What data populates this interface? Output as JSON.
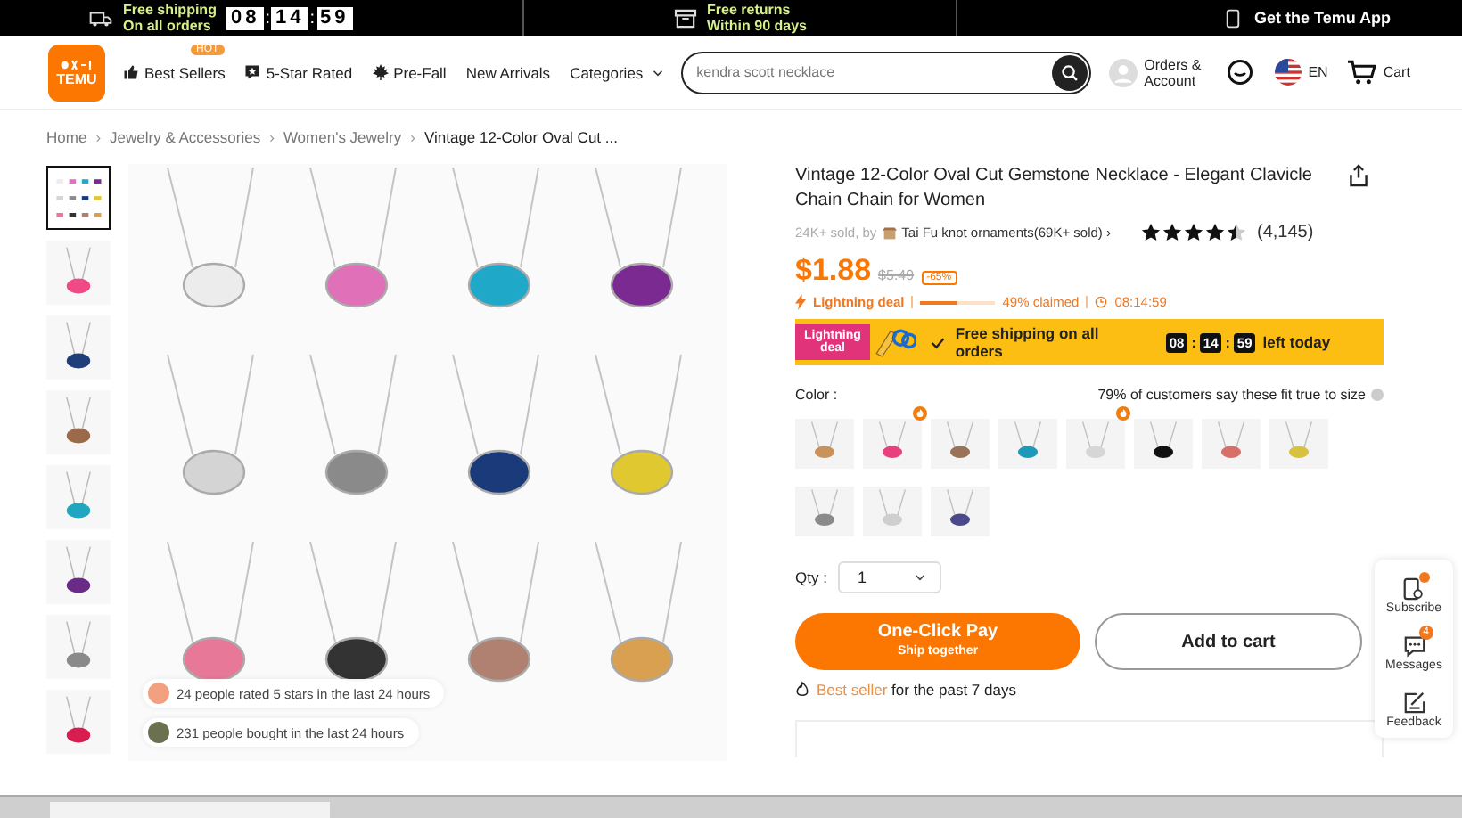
{
  "top_bar": {
    "promos": [
      {
        "kind": "shipping",
        "lines": [
          "Free shipping",
          "On all orders"
        ],
        "timer": {
          "parts": [
            "08",
            "14",
            "59"
          ],
          "separator": ":"
        }
      },
      {
        "kind": "returns",
        "lines": [
          "Free returns",
          "Within 90 days"
        ]
      },
      {
        "kind": "app",
        "lines": [
          "Get the Temu App"
        ]
      }
    ]
  },
  "nav": {
    "logo": "TEMU",
    "links": [
      {
        "label": "Best Sellers",
        "badge": "HOT"
      },
      {
        "label": "5-Star Rated"
      },
      {
        "label": "Pre-Fall"
      },
      {
        "label": "New Arrivals"
      },
      {
        "label": "Categories",
        "dropdown": true
      }
    ],
    "search": {
      "placeholder": "kendra scott necklace"
    },
    "account": [
      "Orders &",
      "Account"
    ],
    "language": "EN",
    "cart": "Cart"
  },
  "breadcrumb": {
    "separator": "›",
    "items": [
      "Home",
      "Jewelry & Accessories",
      "Women's Jewelry",
      "Vintage 12-Color Oval Cut ..."
    ]
  },
  "gallery": {
    "thumbnails": [
      {
        "kind": "grid",
        "selected": true
      },
      {
        "kind": "single",
        "color": "#f04a86",
        "selected": false
      },
      {
        "kind": "single",
        "color": "#1f3f7a",
        "selected": false
      },
      {
        "kind": "single",
        "color": "#9a6a4a",
        "selected": false
      },
      {
        "kind": "single",
        "color": "#1fa6c0",
        "selected": false
      },
      {
        "kind": "single",
        "color": "#6a2a88",
        "selected": false
      },
      {
        "kind": "single",
        "color": "#8a8a8a",
        "selected": false
      },
      {
        "kind": "single",
        "color": "#d81e50",
        "selected": false
      }
    ],
    "social_proof": [
      {
        "kind": "rating",
        "text": "24 people rated 5 stars in the last 24 hours"
      },
      {
        "kind": "bought",
        "text": "231 people bought in the last 24 hours"
      }
    ]
  },
  "product": {
    "title": "Vintage 12-Color Oval Cut Gemstone Necklace - Elegant Clavicle Chain Chain for Women",
    "seller": {
      "sold": "24K+ sold, by",
      "store": "Tai Fu knot ornaments(69K+ sold)",
      "chevron": "›"
    },
    "rating": {
      "stars": 4.5,
      "count": "(4,145)"
    },
    "price": {
      "current": "$1.88",
      "original": "$5.49",
      "discount": "-65%"
    },
    "deal": {
      "label": "Lightning deal",
      "level": 0.49,
      "claimed": "49% claimed",
      "countdown": "08:14:59"
    },
    "banner": {
      "badge_lines": [
        "Lightning",
        "deal"
      ],
      "text": "Free shipping on all orders",
      "timer": {
        "parts": [
          "08",
          "14",
          "59"
        ],
        "separator": ":"
      },
      "suffix": "left today"
    },
    "color_label": "Color :",
    "fit_note": "79% of customers say these fit true to size",
    "swatches": [
      {
        "color": "#c8925a",
        "hot": false
      },
      {
        "color": "#e8407e",
        "hot": true
      },
      {
        "color": "#9a7258",
        "hot": false
      },
      {
        "color": "#1c9ab8",
        "hot": false
      },
      {
        "color": "#d6d6d6",
        "hot": true
      },
      {
        "color": "#111111",
        "hot": false
      },
      {
        "color": "#d8706a",
        "hot": false
      },
      {
        "color": "#d8c040",
        "hot": false
      },
      {
        "color": "#8a8a8a",
        "hot": false
      },
      {
        "color": "#cfcfcf",
        "hot": false
      },
      {
        "color": "#4a4a8a",
        "hot": false
      }
    ],
    "qty": {
      "label": "Qty :",
      "value": "1"
    },
    "buttons": {
      "primary": {
        "label": "One-Click Pay",
        "sub": "Ship together"
      },
      "secondary": "Add to cart"
    },
    "best_seller": {
      "highlight": "Best seller",
      "rest": "for the past 7 days"
    }
  },
  "side_panel": [
    {
      "label": "Subscribe",
      "dot": true
    },
    {
      "label": "Messages",
      "badge": "4"
    },
    {
      "label": "Feedback"
    }
  ]
}
